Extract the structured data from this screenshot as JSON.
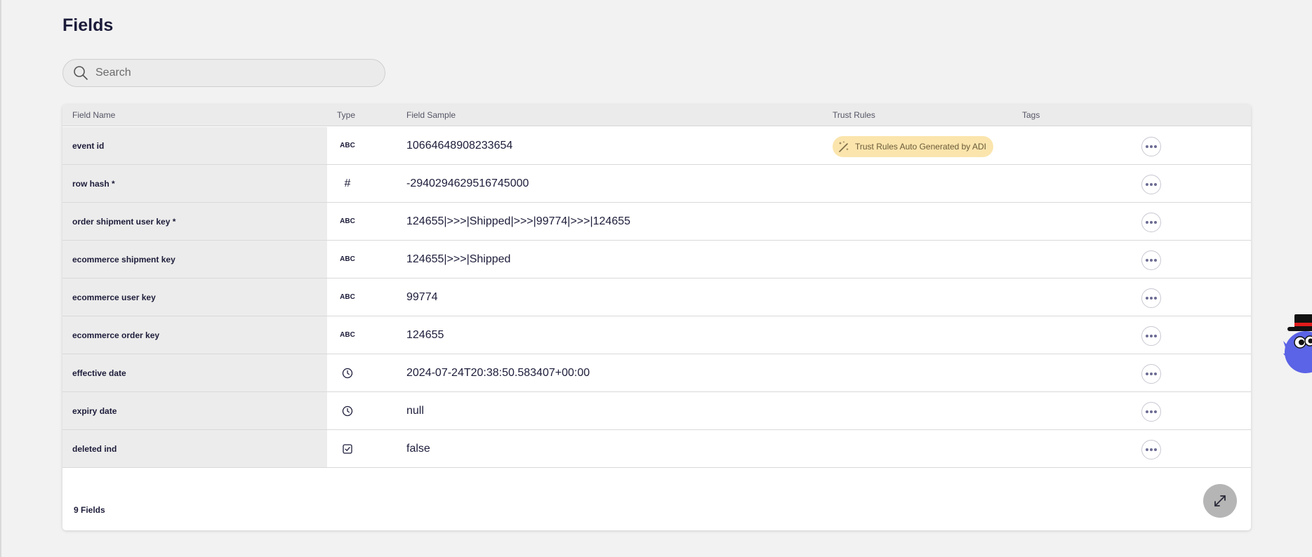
{
  "page": {
    "title": "Fields"
  },
  "search": {
    "placeholder": "Search"
  },
  "table": {
    "headers": {
      "field_name": "Field Name",
      "type": "Type",
      "field_sample": "Field Sample",
      "trust_rules": "Trust Rules",
      "tags": "Tags"
    },
    "rows": [
      {
        "name": "event id",
        "type_label": "ABC",
        "type_icon": "text-type",
        "sample": "10664648908233654",
        "trust_rule": "Trust Rules Auto Generated by ADI"
      },
      {
        "name": "row hash *",
        "type_label": "#",
        "type_icon": "number-type",
        "sample": "-2940294629516745000"
      },
      {
        "name": "order shipment user key *",
        "type_label": "ABC",
        "type_icon": "text-type",
        "sample": "124655|>>>|Shipped|>>>|99774|>>>|124655"
      },
      {
        "name": "ecommerce shipment key",
        "type_label": "ABC",
        "type_icon": "text-type",
        "sample": "124655|>>>|Shipped"
      },
      {
        "name": "ecommerce user key",
        "type_label": "ABC",
        "type_icon": "text-type",
        "sample": "99774"
      },
      {
        "name": "ecommerce order key",
        "type_label": "ABC",
        "type_icon": "text-type",
        "sample": "124655"
      },
      {
        "name": "effective date",
        "type_label": "",
        "type_icon": "clock-icon",
        "sample": "2024-07-24T20:38:50.583407+00:00"
      },
      {
        "name": "expiry date",
        "type_label": "",
        "type_icon": "clock-icon",
        "sample": "null"
      },
      {
        "name": "deleted ind",
        "type_label": "",
        "type_icon": "checkbox-icon",
        "sample": "false"
      }
    ]
  },
  "footer": {
    "count": "9 Fields"
  },
  "colors": {
    "background": "#f2f2f2",
    "text": "#1c1c3a",
    "badge_bg": "#fbe5ad",
    "badge_text": "#6a5a38",
    "mascot": "#5b63e6"
  }
}
